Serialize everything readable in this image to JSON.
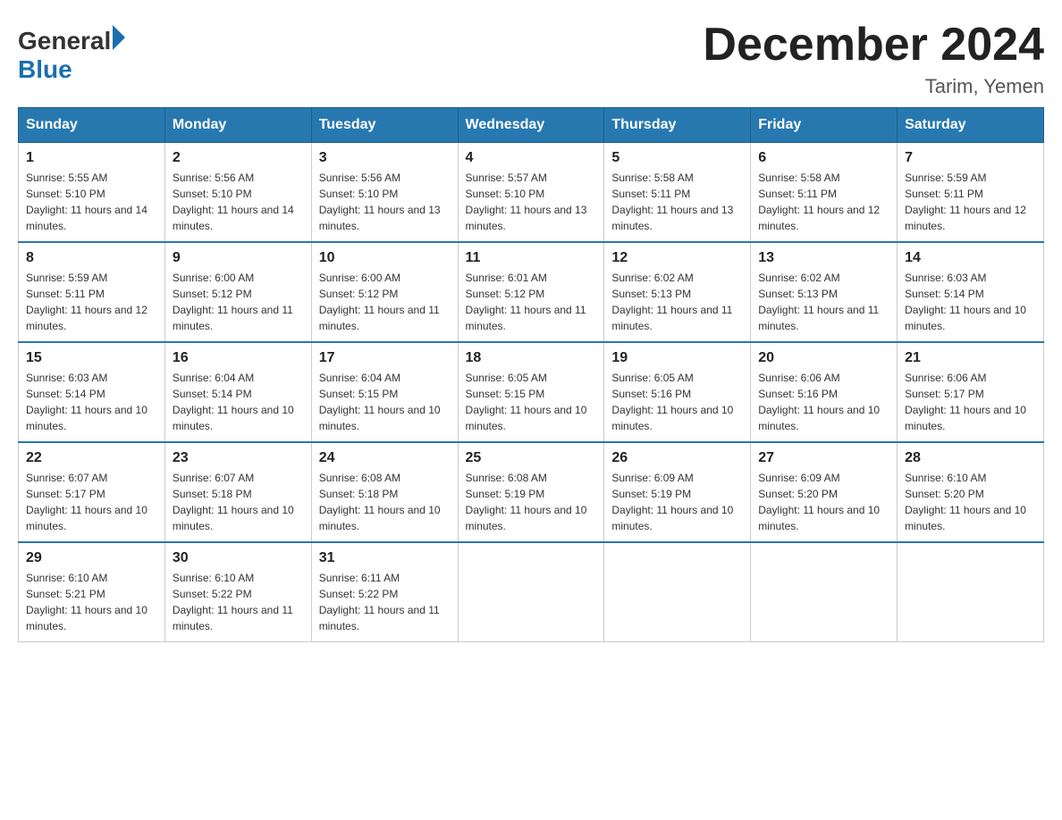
{
  "header": {
    "logo": {
      "general": "General",
      "blue": "Blue"
    },
    "title": "December 2024",
    "subtitle": "Tarim, Yemen"
  },
  "days_of_week": [
    "Sunday",
    "Monday",
    "Tuesday",
    "Wednesday",
    "Thursday",
    "Friday",
    "Saturday"
  ],
  "weeks": [
    [
      {
        "day": "1",
        "sunrise": "5:55 AM",
        "sunset": "5:10 PM",
        "daylight": "11 hours and 14 minutes."
      },
      {
        "day": "2",
        "sunrise": "5:56 AM",
        "sunset": "5:10 PM",
        "daylight": "11 hours and 14 minutes."
      },
      {
        "day": "3",
        "sunrise": "5:56 AM",
        "sunset": "5:10 PM",
        "daylight": "11 hours and 13 minutes."
      },
      {
        "day": "4",
        "sunrise": "5:57 AM",
        "sunset": "5:10 PM",
        "daylight": "11 hours and 13 minutes."
      },
      {
        "day": "5",
        "sunrise": "5:58 AM",
        "sunset": "5:11 PM",
        "daylight": "11 hours and 13 minutes."
      },
      {
        "day": "6",
        "sunrise": "5:58 AM",
        "sunset": "5:11 PM",
        "daylight": "11 hours and 12 minutes."
      },
      {
        "day": "7",
        "sunrise": "5:59 AM",
        "sunset": "5:11 PM",
        "daylight": "11 hours and 12 minutes."
      }
    ],
    [
      {
        "day": "8",
        "sunrise": "5:59 AM",
        "sunset": "5:11 PM",
        "daylight": "11 hours and 12 minutes."
      },
      {
        "day": "9",
        "sunrise": "6:00 AM",
        "sunset": "5:12 PM",
        "daylight": "11 hours and 11 minutes."
      },
      {
        "day": "10",
        "sunrise": "6:00 AM",
        "sunset": "5:12 PM",
        "daylight": "11 hours and 11 minutes."
      },
      {
        "day": "11",
        "sunrise": "6:01 AM",
        "sunset": "5:12 PM",
        "daylight": "11 hours and 11 minutes."
      },
      {
        "day": "12",
        "sunrise": "6:02 AM",
        "sunset": "5:13 PM",
        "daylight": "11 hours and 11 minutes."
      },
      {
        "day": "13",
        "sunrise": "6:02 AM",
        "sunset": "5:13 PM",
        "daylight": "11 hours and 11 minutes."
      },
      {
        "day": "14",
        "sunrise": "6:03 AM",
        "sunset": "5:14 PM",
        "daylight": "11 hours and 10 minutes."
      }
    ],
    [
      {
        "day": "15",
        "sunrise": "6:03 AM",
        "sunset": "5:14 PM",
        "daylight": "11 hours and 10 minutes."
      },
      {
        "day": "16",
        "sunrise": "6:04 AM",
        "sunset": "5:14 PM",
        "daylight": "11 hours and 10 minutes."
      },
      {
        "day": "17",
        "sunrise": "6:04 AM",
        "sunset": "5:15 PM",
        "daylight": "11 hours and 10 minutes."
      },
      {
        "day": "18",
        "sunrise": "6:05 AM",
        "sunset": "5:15 PM",
        "daylight": "11 hours and 10 minutes."
      },
      {
        "day": "19",
        "sunrise": "6:05 AM",
        "sunset": "5:16 PM",
        "daylight": "11 hours and 10 minutes."
      },
      {
        "day": "20",
        "sunrise": "6:06 AM",
        "sunset": "5:16 PM",
        "daylight": "11 hours and 10 minutes."
      },
      {
        "day": "21",
        "sunrise": "6:06 AM",
        "sunset": "5:17 PM",
        "daylight": "11 hours and 10 minutes."
      }
    ],
    [
      {
        "day": "22",
        "sunrise": "6:07 AM",
        "sunset": "5:17 PM",
        "daylight": "11 hours and 10 minutes."
      },
      {
        "day": "23",
        "sunrise": "6:07 AM",
        "sunset": "5:18 PM",
        "daylight": "11 hours and 10 minutes."
      },
      {
        "day": "24",
        "sunrise": "6:08 AM",
        "sunset": "5:18 PM",
        "daylight": "11 hours and 10 minutes."
      },
      {
        "day": "25",
        "sunrise": "6:08 AM",
        "sunset": "5:19 PM",
        "daylight": "11 hours and 10 minutes."
      },
      {
        "day": "26",
        "sunrise": "6:09 AM",
        "sunset": "5:19 PM",
        "daylight": "11 hours and 10 minutes."
      },
      {
        "day": "27",
        "sunrise": "6:09 AM",
        "sunset": "5:20 PM",
        "daylight": "11 hours and 10 minutes."
      },
      {
        "day": "28",
        "sunrise": "6:10 AM",
        "sunset": "5:20 PM",
        "daylight": "11 hours and 10 minutes."
      }
    ],
    [
      {
        "day": "29",
        "sunrise": "6:10 AM",
        "sunset": "5:21 PM",
        "daylight": "11 hours and 10 minutes."
      },
      {
        "day": "30",
        "sunrise": "6:10 AM",
        "sunset": "5:22 PM",
        "daylight": "11 hours and 11 minutes."
      },
      {
        "day": "31",
        "sunrise": "6:11 AM",
        "sunset": "5:22 PM",
        "daylight": "11 hours and 11 minutes."
      },
      null,
      null,
      null,
      null
    ]
  ]
}
